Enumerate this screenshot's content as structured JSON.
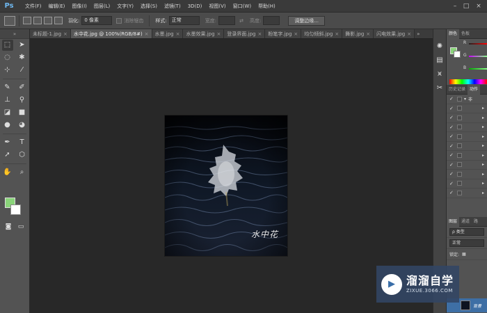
{
  "app": {
    "logo": "Ps",
    "menu": [
      "文件(F)",
      "编辑(E)",
      "图像(I)",
      "图层(L)",
      "文字(Y)",
      "选择(S)",
      "滤镜(T)",
      "3D(D)",
      "视图(V)",
      "窗口(W)",
      "帮助(H)"
    ]
  },
  "options": {
    "feather_label": "羽化:",
    "feather_value": "0 像素",
    "antialias_label": "消除锯齿",
    "style_label": "样式:",
    "style_value": "正常",
    "width_label": "宽度:",
    "height_label": "高度:",
    "refine_edge_button": "调整边缘..."
  },
  "tabs": [
    {
      "label": "未标题-1.jpg",
      "close": "×",
      "active": false
    },
    {
      "label": "水中花.jpg @ 100%(RGB/8#)",
      "close": "×",
      "active": true
    },
    {
      "label": "水墨.jpg",
      "close": "×",
      "active": false
    },
    {
      "label": "水墨效果.jpg",
      "close": "×",
      "active": false
    },
    {
      "label": "登录界面.jpg",
      "close": "×",
      "active": false
    },
    {
      "label": "粉笔字.jpg",
      "close": "×",
      "active": false
    },
    {
      "label": "均匀倾斜.jpg",
      "close": "×",
      "active": false
    },
    {
      "label": "舞影.jpg",
      "close": "×",
      "active": false
    },
    {
      "label": "闪电效果.jpg",
      "close": "×",
      "active": false
    }
  ],
  "tabs_more": "»",
  "document": {
    "caption": "水中花"
  },
  "toolbar": {
    "grip": "»",
    "tools": [
      [
        "⬚",
        "➤"
      ],
      [
        "◌",
        "✱"
      ],
      [
        "⊹",
        "⁄"
      ],
      [
        "✎",
        "✐"
      ],
      [
        "⊥",
        "⚲"
      ],
      [
        "◪",
        "■"
      ],
      [
        "●",
        "◕"
      ],
      [
        "✒",
        "T"
      ],
      [
        "➚",
        "⬡"
      ],
      [
        "✋",
        "⌕"
      ]
    ],
    "fg_color": "#8ad47a",
    "bg_color": "#ffffff"
  },
  "panels": {
    "color_tab": "颜色",
    "swatch_tab": "色板",
    "channels": [
      "R",
      "G",
      "B"
    ],
    "history_tab": "历史记录",
    "actions_tab": "动作",
    "history_first": "非",
    "history_rows": 10,
    "layers_tab": "图层",
    "channels_tab": "通道",
    "paths_tab": "路",
    "kind_label": "ρ 类型",
    "blend_mode": "正常",
    "lock_label": "锁定:",
    "layer_name": "背景"
  },
  "watermark": {
    "title": "溜溜自学",
    "url": "ZIXUE.3066.COM"
  }
}
